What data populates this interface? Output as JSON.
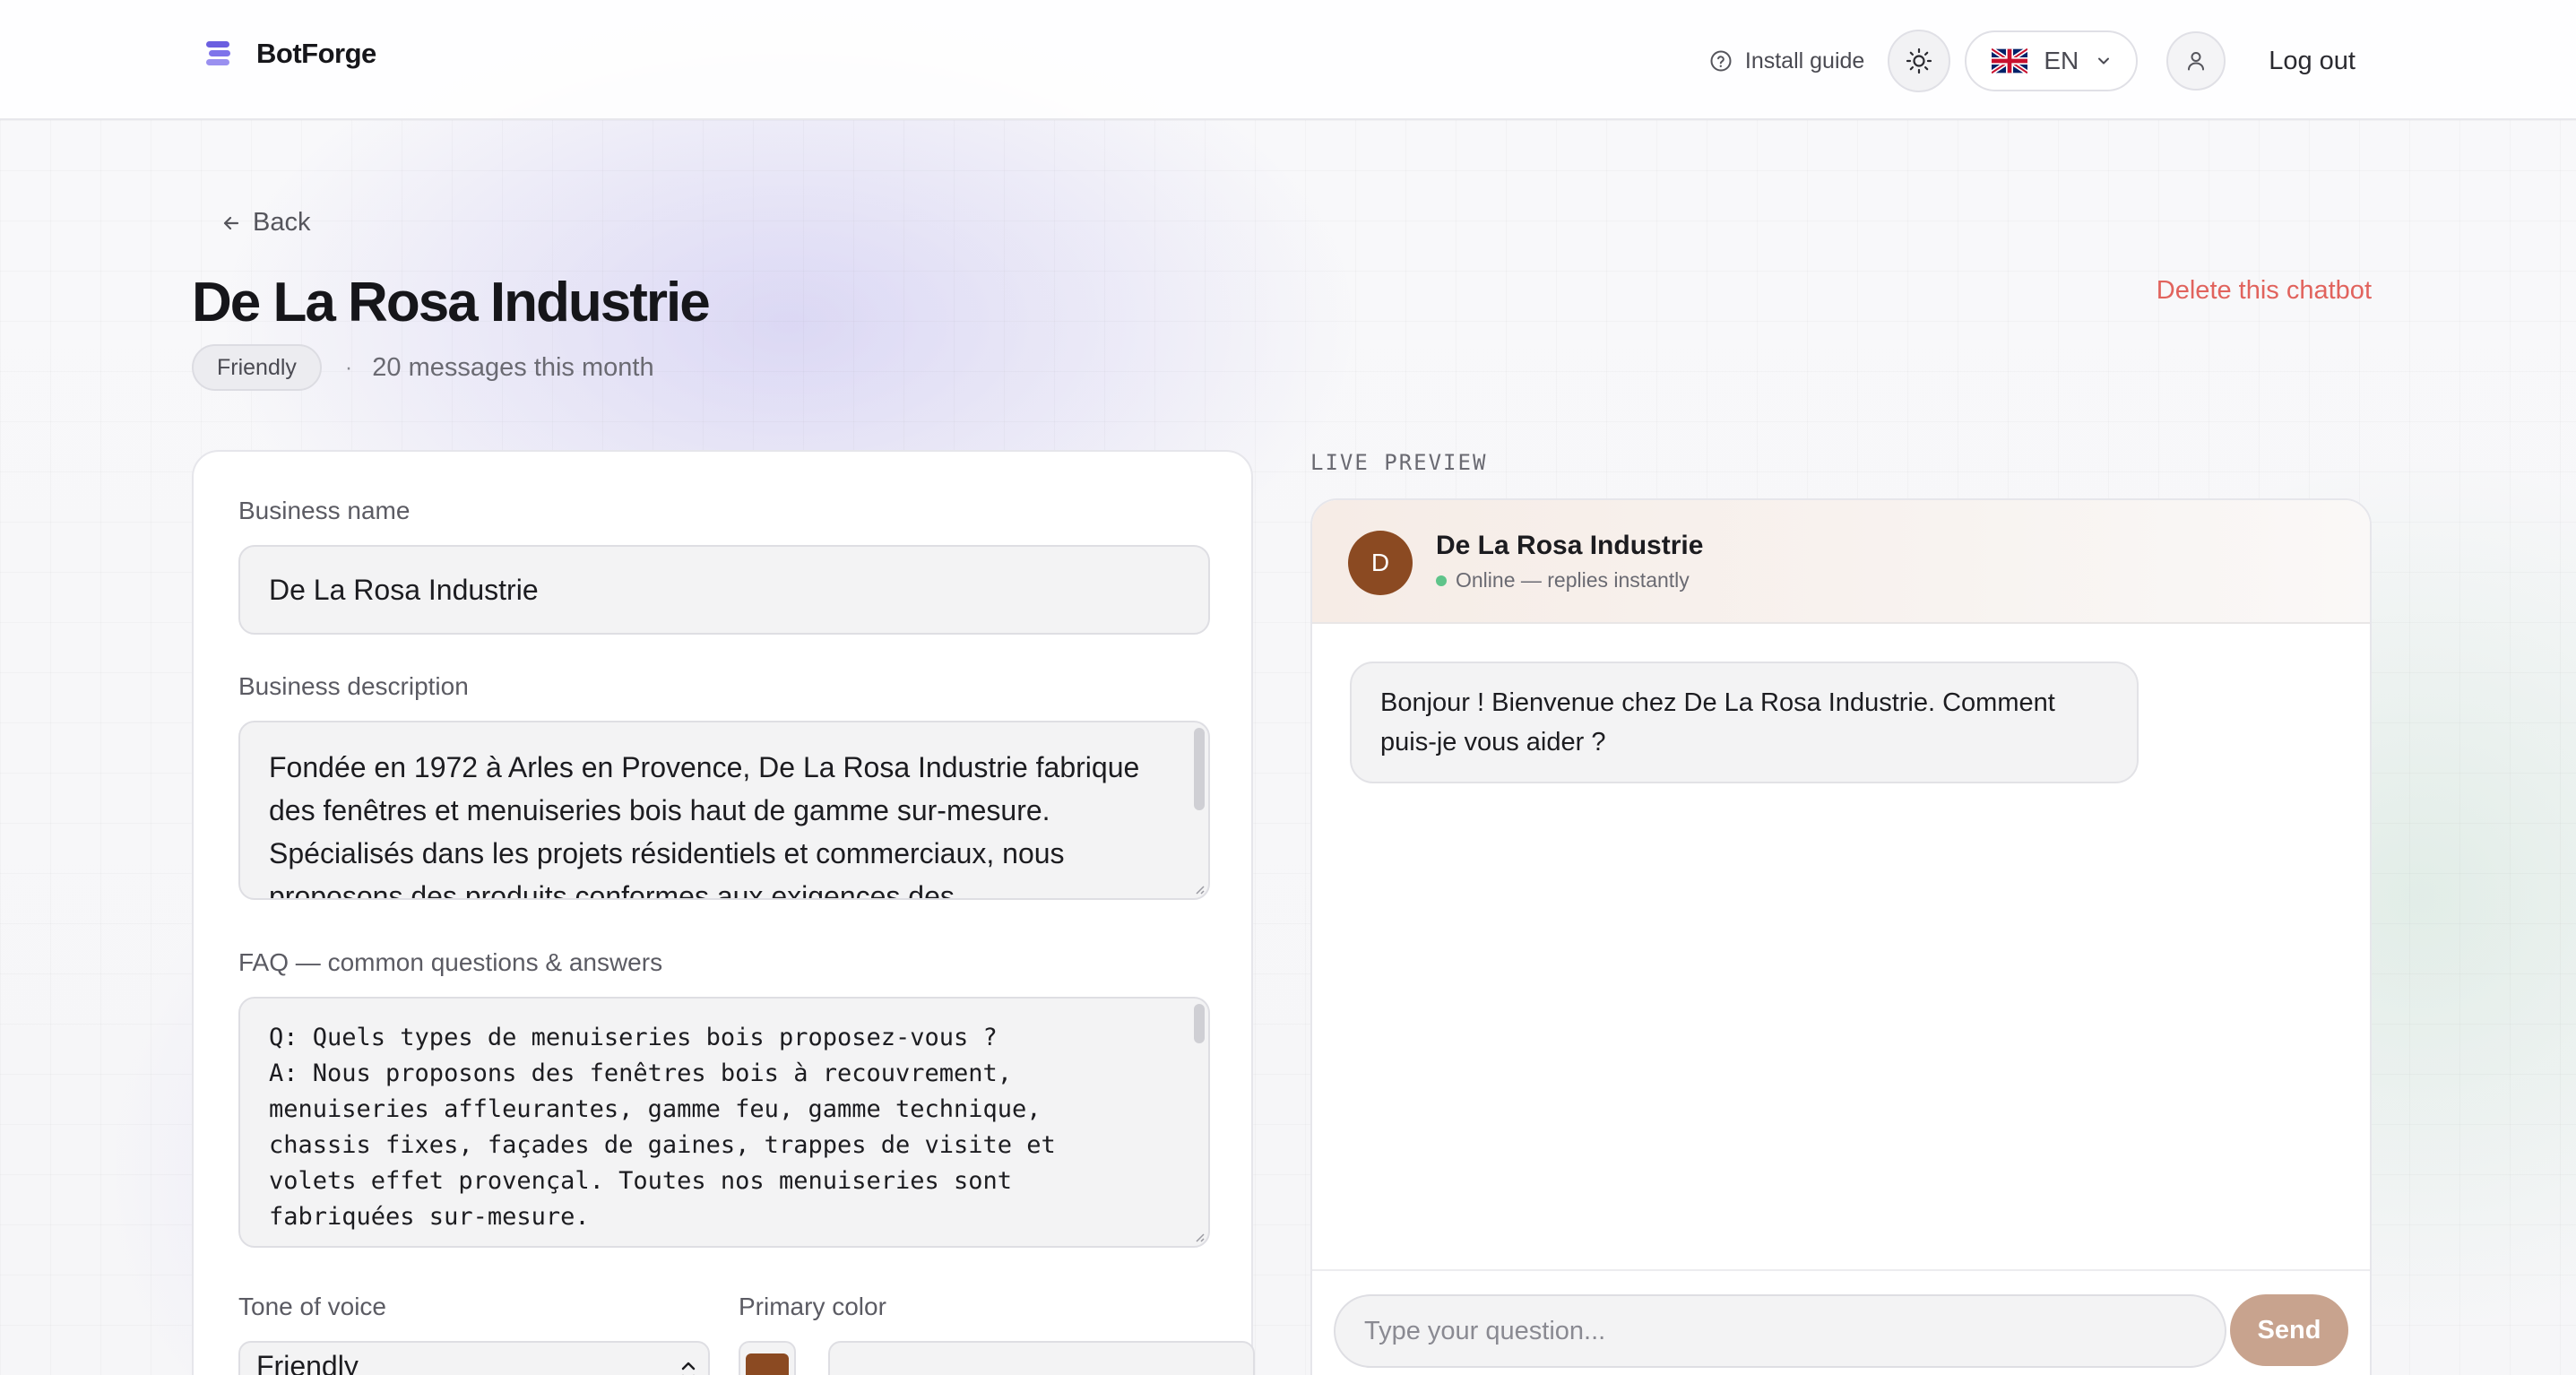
{
  "brand": {
    "name": "BotForge",
    "logo_icon": "stack-logo-icon"
  },
  "nav": {
    "install_guide": "Install guide",
    "theme_icon": "sun-icon",
    "language": "EN",
    "user_icon": "user-icon",
    "logout": "Log out"
  },
  "page": {
    "back": "Back",
    "title": "De La Rosa Industrie",
    "tone_badge": "Friendly",
    "separator": "·",
    "message_count": "20 messages this month",
    "delete": "Delete this chatbot"
  },
  "form": {
    "business_name": {
      "label": "Business name",
      "value": "De La Rosa Industrie"
    },
    "business_description": {
      "label": "Business description",
      "value": "Fondée en 1972 à Arles en Provence, De La Rosa Industrie fabrique des fenêtres et menuiseries bois haut de gamme sur-mesure. Spécialisés dans les projets résidentiels et commerciaux, nous proposons des produits conformes aux exigences des"
    },
    "faq": {
      "label": "FAQ — common questions & answers",
      "value": "Q: Quels types de menuiseries bois proposez-vous ?\nA: Nous proposons des fenêtres bois à recouvrement,\nmenuiseries affleurantes, gamme feu, gamme technique,\nchassis fixes, façades de gaines, trappes de visite et\nvolets effet provençal. Toutes nos menuiseries sont\nfabriquées sur-mesure."
    },
    "tone": {
      "label": "Tone of voice",
      "value": "Friendly"
    },
    "primary_color": {
      "label": "Primary color",
      "value": "#8b4a22"
    }
  },
  "preview": {
    "label": "LIVE PREVIEW",
    "avatar_letter": "D",
    "bot_name": "De La Rosa Industrie",
    "status": "Online — replies instantly",
    "greeting": "Bonjour ! Bienvenue chez De La Rosa Industrie. Comment puis-je vous aider ?",
    "input_placeholder": "Type your question...",
    "send": "Send"
  },
  "colors": {
    "accent_brown": "#8b4a22",
    "send_button": "#c8a38e",
    "status_online": "#5fc48a",
    "danger": "#e1635d",
    "brand_purple": "#6b5fe0"
  }
}
